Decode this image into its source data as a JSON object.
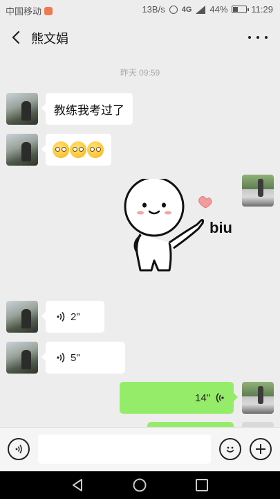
{
  "status": {
    "carrier": "中国移动",
    "speed": "13B/s",
    "network": "4G",
    "battery": "44%",
    "battery_level": 0.44,
    "time": "11:29"
  },
  "header": {
    "title": "熊文娟"
  },
  "chat": {
    "timestamp": "昨天 09:59",
    "messages": [
      {
        "from": "other",
        "type": "text",
        "text": "教练我考过了"
      },
      {
        "from": "other",
        "type": "emoji",
        "emoji_count": 3
      },
      {
        "from": "self",
        "type": "sticker",
        "sticker_text": "biu"
      },
      {
        "from": "other",
        "type": "voice",
        "duration": "2\""
      },
      {
        "from": "other",
        "type": "voice",
        "duration": "5\""
      },
      {
        "from": "self",
        "type": "voice",
        "duration": "14\""
      }
    ]
  },
  "colors": {
    "bg": "#ededed",
    "self_bubble": "#95ec69",
    "other_bubble": "#ffffff"
  },
  "icons": {
    "back": "chevron-left-icon",
    "more": "more-dots-icon",
    "voice_input": "voice-input-icon",
    "emoji": "smiley-icon",
    "add": "plus-icon"
  }
}
